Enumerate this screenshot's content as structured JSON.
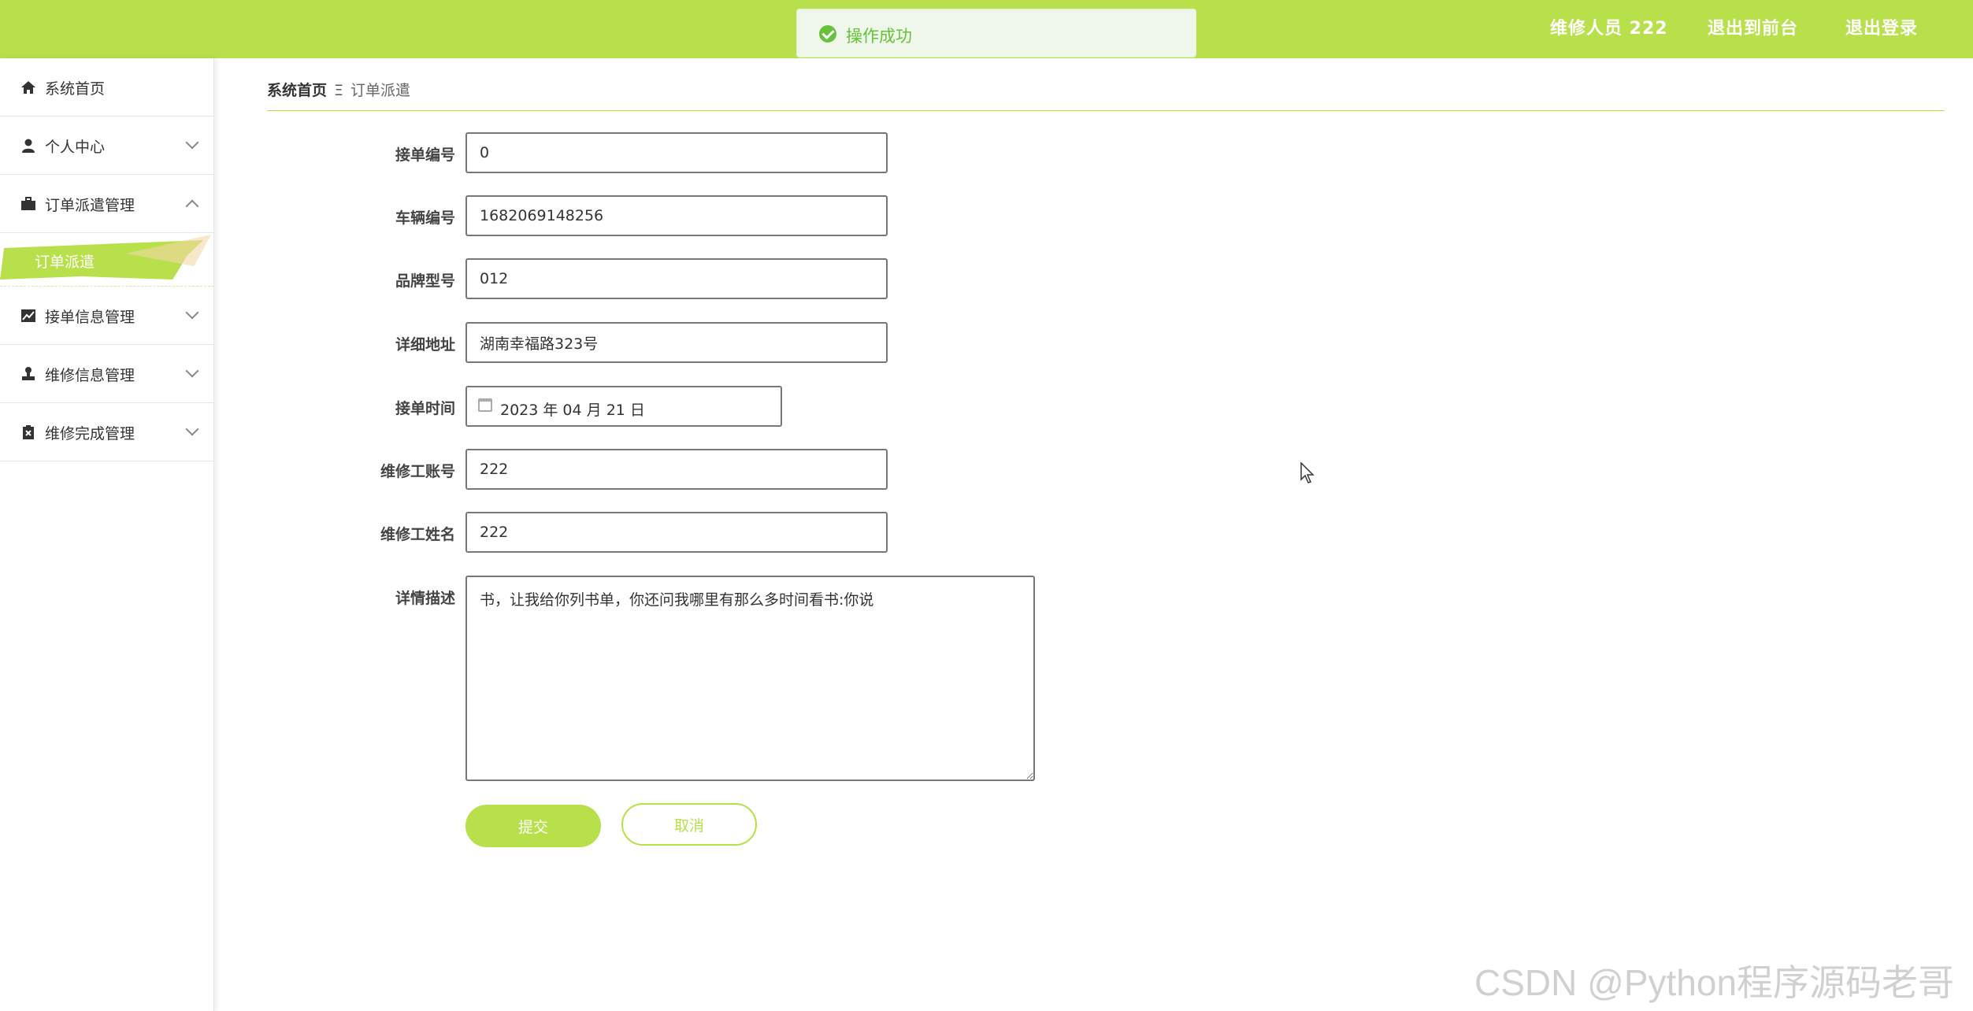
{
  "header": {
    "user": "维修人员 222",
    "front_link": "退出到前台",
    "logout_link": "退出登录",
    "accent_color": "#b8e04a"
  },
  "toast": {
    "message": "操作成功",
    "icon": "check-circle-icon"
  },
  "sidebar": {
    "items": [
      {
        "label": "系统首页",
        "icon": "home-icon"
      },
      {
        "label": "个人中心",
        "icon": "user-icon"
      },
      {
        "label": "订单派遣管理",
        "icon": "briefcase-icon"
      },
      {
        "label": "接单信息管理",
        "icon": "chart-icon"
      },
      {
        "label": "维修信息管理",
        "icon": "stamp-icon"
      },
      {
        "label": "维修完成管理",
        "icon": "clipboard-icon"
      }
    ],
    "active_sub": "订单派遣"
  },
  "breadcrumb": {
    "home": "系统首页",
    "separator": "Ξ",
    "current": "订单派遣"
  },
  "form": {
    "order_no": {
      "label": "接单编号",
      "value": "0"
    },
    "vehicle_no": {
      "label": "车辆编号",
      "value": "1682069148256"
    },
    "model": {
      "label": "品牌型号",
      "value": "012"
    },
    "address": {
      "label": "详细地址",
      "value": "湖南幸福路323号"
    },
    "order_time": {
      "label": "接单时间",
      "value": "2023 年 04 月 21 日"
    },
    "worker_account": {
      "label": "维修工账号",
      "value": "222"
    },
    "worker_name": {
      "label": "维修工姓名",
      "value": "222"
    },
    "description": {
      "label": "详情描述",
      "value": "书，让我给你列书单，你还问我哪里有那么多时间看书:你说"
    },
    "submit": "提交",
    "cancel": "取消"
  },
  "watermark": "CSDN @Python程序源码老哥"
}
